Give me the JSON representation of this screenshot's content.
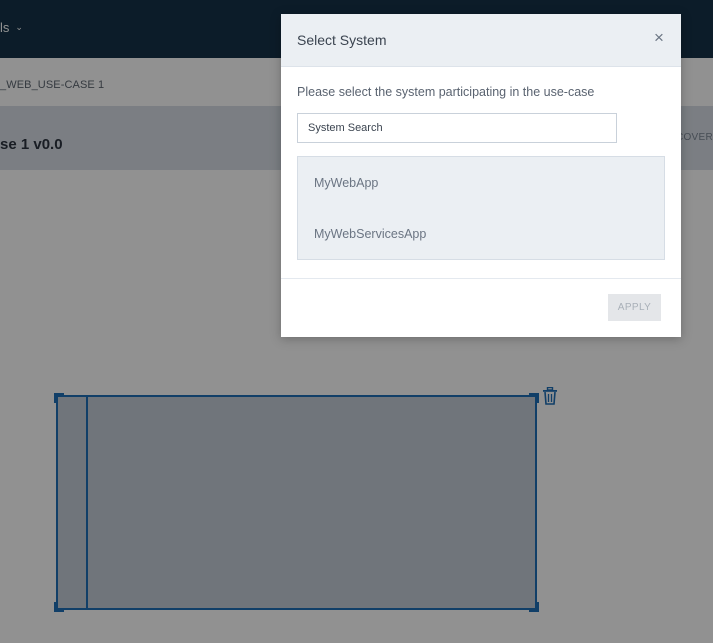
{
  "app": {
    "menu_label": "ls",
    "breadcrumb": "_WEB_USE-CASE 1",
    "page_title": "se 1 v0.0",
    "right_tab_label": "COVER"
  },
  "canvas": {
    "selected_element": "pool",
    "delete_icon": "trash-icon"
  },
  "modal": {
    "title": "Select System",
    "close_glyph": "×",
    "instructions": "Please select the system participating in the use-case",
    "search": {
      "placeholder": "System Search",
      "value": ""
    },
    "systems": [
      {
        "label": "MyWebApp"
      },
      {
        "label": "MyWebServicesApp"
      }
    ],
    "apply_label": "APPLY",
    "apply_enabled": false
  },
  "colors": {
    "topbar": "#163248",
    "accent": "#1f6fb7",
    "overlay": "rgba(0,0,0,0.43)",
    "modal_header": "#ebeff3"
  }
}
